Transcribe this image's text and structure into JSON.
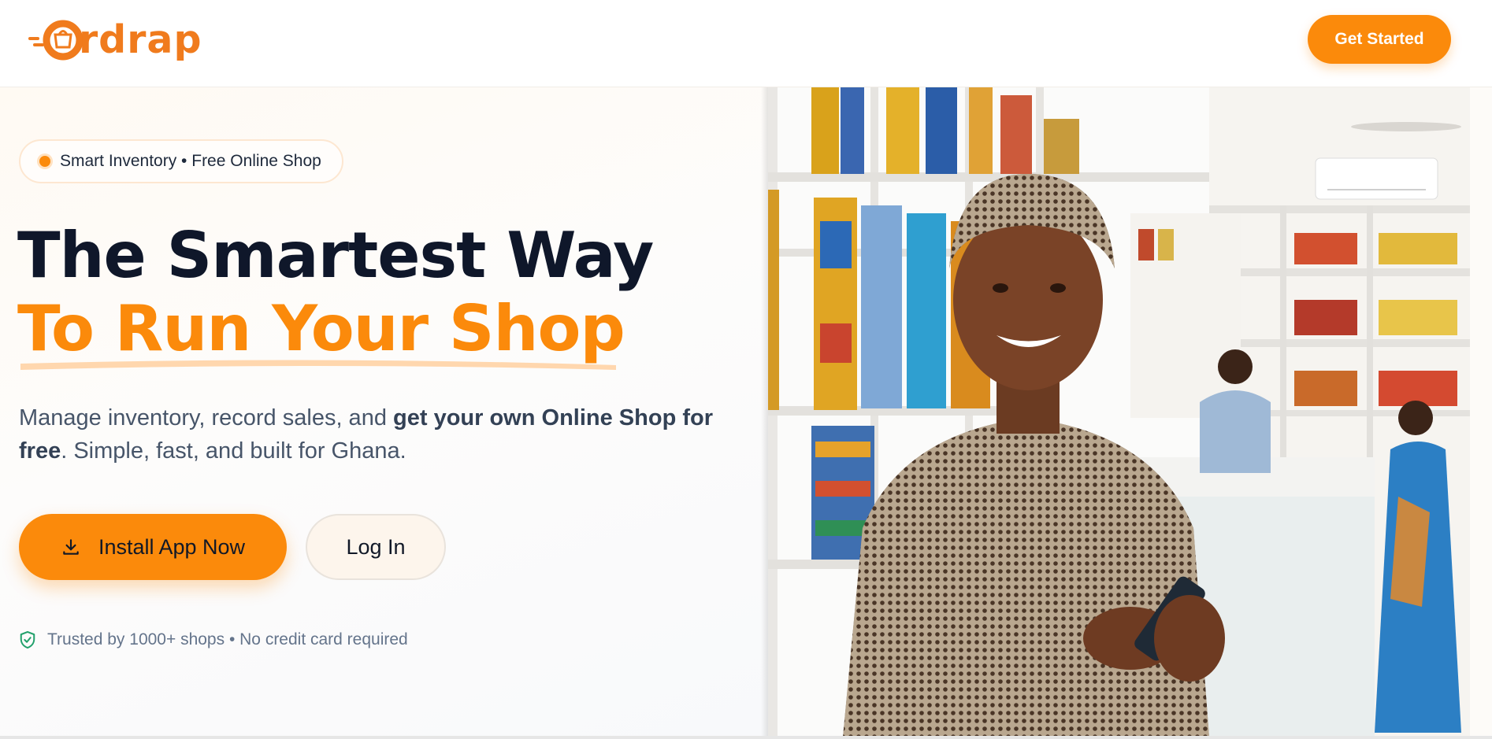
{
  "brand": {
    "name": "rdrap",
    "color": "#f07b1d"
  },
  "header": {
    "cta_label": "Get Started"
  },
  "hero": {
    "badge": "Smart Inventory • Free Online Shop",
    "headline_line1": "The Smartest Way",
    "headline_line2": "To Run Your Shop",
    "description": {
      "part1": "Manage inventory, record sales, and ",
      "bold1": "get your own Online Shop for free",
      "part2": ". Simple, fast, and built for Ghana."
    },
    "install_button": "Install App Now",
    "login_button": "Log In",
    "trust_text": "Trusted by 1000+ shops • No credit card required"
  },
  "colors": {
    "accent": "#fb8a0b",
    "heading": "#0f172a",
    "body_text": "#475569",
    "trust_icon": "#22a06b"
  },
  "icons": {
    "logo": "shopping-bag-speed-icon",
    "download": "download-icon",
    "trust": "shield-check-icon"
  }
}
